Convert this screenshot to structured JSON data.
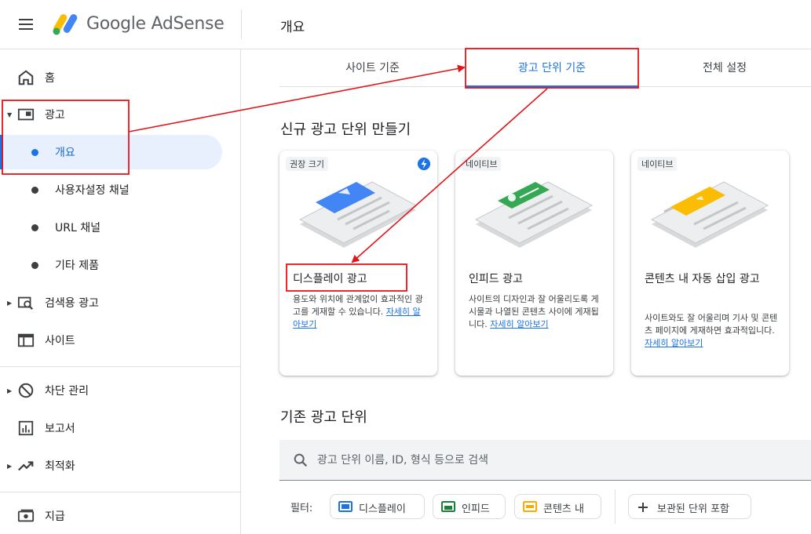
{
  "header": {
    "brand": "Google AdSense",
    "page_title": "개요"
  },
  "sidebar": {
    "items": [
      {
        "label": "홈",
        "icon": "home-icon"
      },
      {
        "label": "광고",
        "icon": "ads-icon",
        "expanded": true
      },
      {
        "label": "검색용 광고",
        "icon": "search-ads-icon"
      },
      {
        "label": "사이트",
        "icon": "site-icon"
      },
      {
        "label": "차단 관리",
        "icon": "block-icon"
      },
      {
        "label": "보고서",
        "icon": "reports-icon"
      },
      {
        "label": "최적화",
        "icon": "trending-icon"
      },
      {
        "label": "지급",
        "icon": "payments-icon"
      }
    ],
    "ads_subitems": [
      {
        "label": "개요",
        "active": true
      },
      {
        "label": "사용자설정 채널"
      },
      {
        "label": "URL 채널"
      },
      {
        "label": "기타 제품"
      }
    ]
  },
  "tabs": [
    {
      "label": "사이트 기준"
    },
    {
      "label": "광고 단위 기준",
      "active": true
    },
    {
      "label": "전체 설정"
    }
  ],
  "create_section": {
    "title": "신규 광고 단위 만들기",
    "cards": [
      {
        "badge": "권장 크기",
        "title": "디스플레이 광고",
        "description": "용도와 위치에 관계없이 효과적인 광고를 게재할 수 있습니다.",
        "link": "자세히 알아보기",
        "accent": "#4285f4"
      },
      {
        "badge": "네이티브",
        "title": "인피드 광고",
        "description": "사이트의 디자인과 잘 어울리도록 게시물과 나열된 콘텐츠 사이에 게재됩니다.",
        "link": "자세히 알아보기",
        "accent": "#34a853"
      },
      {
        "badge": "네이티브",
        "title": "콘텐츠 내 자동 삽입 광고",
        "description": "사이트와도 잘 어울리며 기사 및 콘텐츠 페이지에 게재하면 효과적입니다.",
        "link": "자세히 알아보기",
        "accent": "#fbbc04"
      }
    ]
  },
  "existing_section": {
    "title": "기존 광고 단위",
    "search_placeholder": "광고 단위 이름, ID, 형식 등으로 검색",
    "filter_label": "필터:",
    "filters": [
      {
        "label": "디스플레이",
        "color": "#1a73e8"
      },
      {
        "label": "인피드",
        "color": "#188038"
      },
      {
        "label": "콘텐츠 내",
        "color": "#f9ab00"
      }
    ],
    "include_archived": "보관된 단위 포함"
  },
  "annotation_color": "#e0161b"
}
